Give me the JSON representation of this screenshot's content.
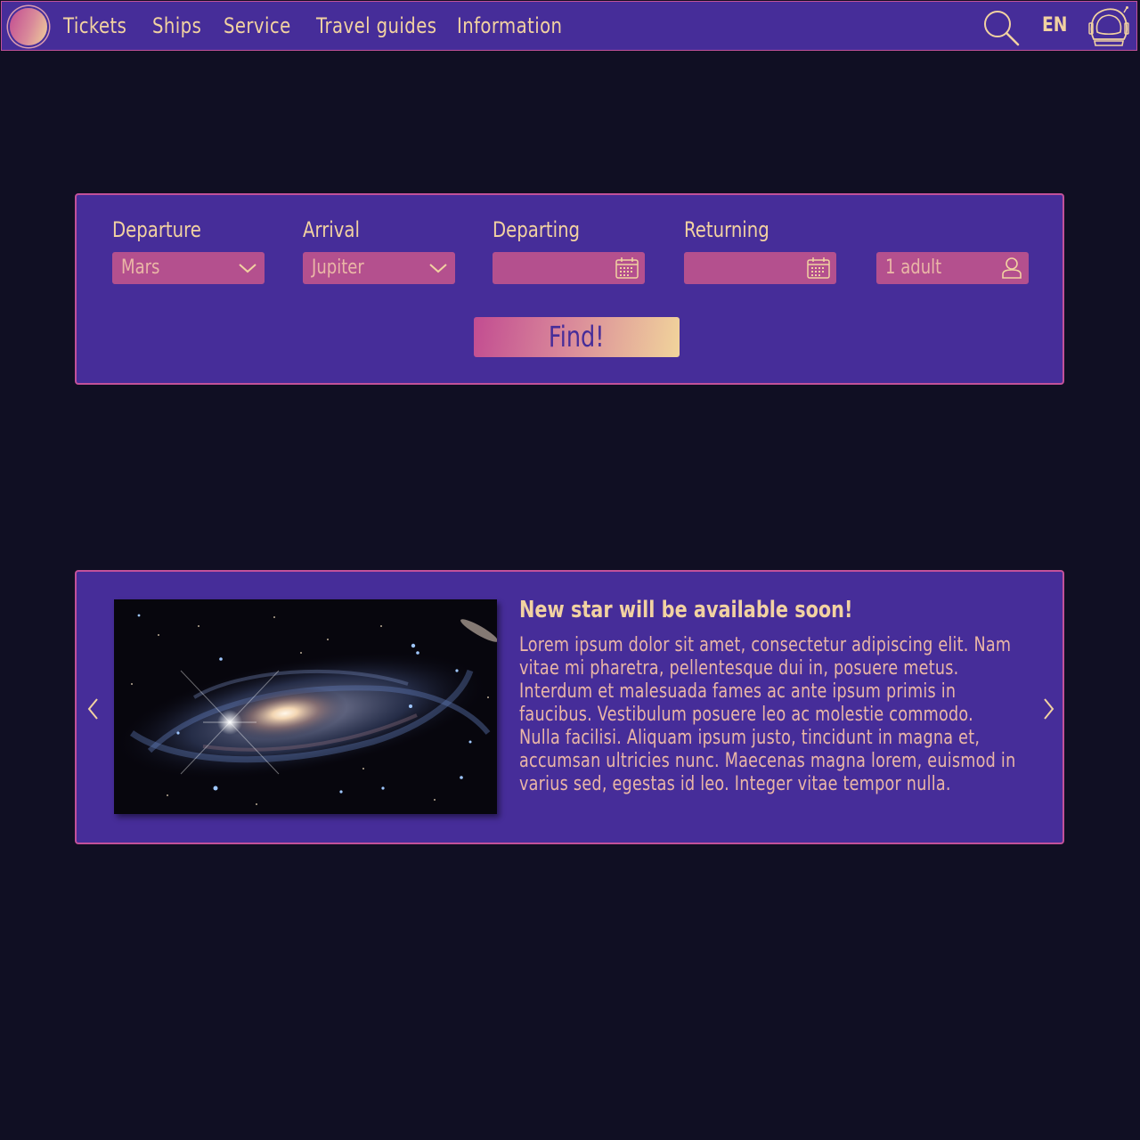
{
  "nav": {
    "logo": "planet-logo",
    "items": [
      "Tickets",
      "Ships",
      "Service",
      "Travel guides",
      "Information"
    ],
    "language": "EN",
    "search_icon": "search-icon",
    "profile_icon": "astronaut-helmet-icon"
  },
  "search": {
    "departure": {
      "label": "Departure",
      "value": "Mars",
      "icon": "chevron-down-icon"
    },
    "arrival": {
      "label": "Arrival",
      "value": "Jupiter",
      "icon": "chevron-down-icon"
    },
    "departing": {
      "label": "Departing",
      "value": "",
      "icon": "calendar-icon"
    },
    "returning": {
      "label": "Returning",
      "value": "",
      "icon": "calendar-icon"
    },
    "passengers": {
      "value": "1 adult",
      "icon": "person-icon"
    },
    "find_label": "Find!"
  },
  "news": {
    "title": "New star will be available soon!",
    "body": "Lorem ipsum dolor sit amet, consectetur adipiscing elit. Nam vitae mi pharetra, pellentesque dui in, posuere metus. Interdum et malesuada fames ac ante ipsum primis in faucibus. Vestibulum posuere leo ac molestie commodo. Nulla facilisi. Aliquam ipsum justo, tincidunt in magna et, accumsan ultricies nunc. Maecenas magna lorem, euismod in varius sed, egestas id leo. Integer vitae tempor nulla.",
    "image": "spiral-galaxy-photo",
    "prev_icon": "chevron-left-icon",
    "next_icon": "chevron-right-icon"
  },
  "colors": {
    "background": "#100f23",
    "panel": "#462d99",
    "border": "#c2519a",
    "field": "#b4508e",
    "text": "#f2d2a1"
  }
}
